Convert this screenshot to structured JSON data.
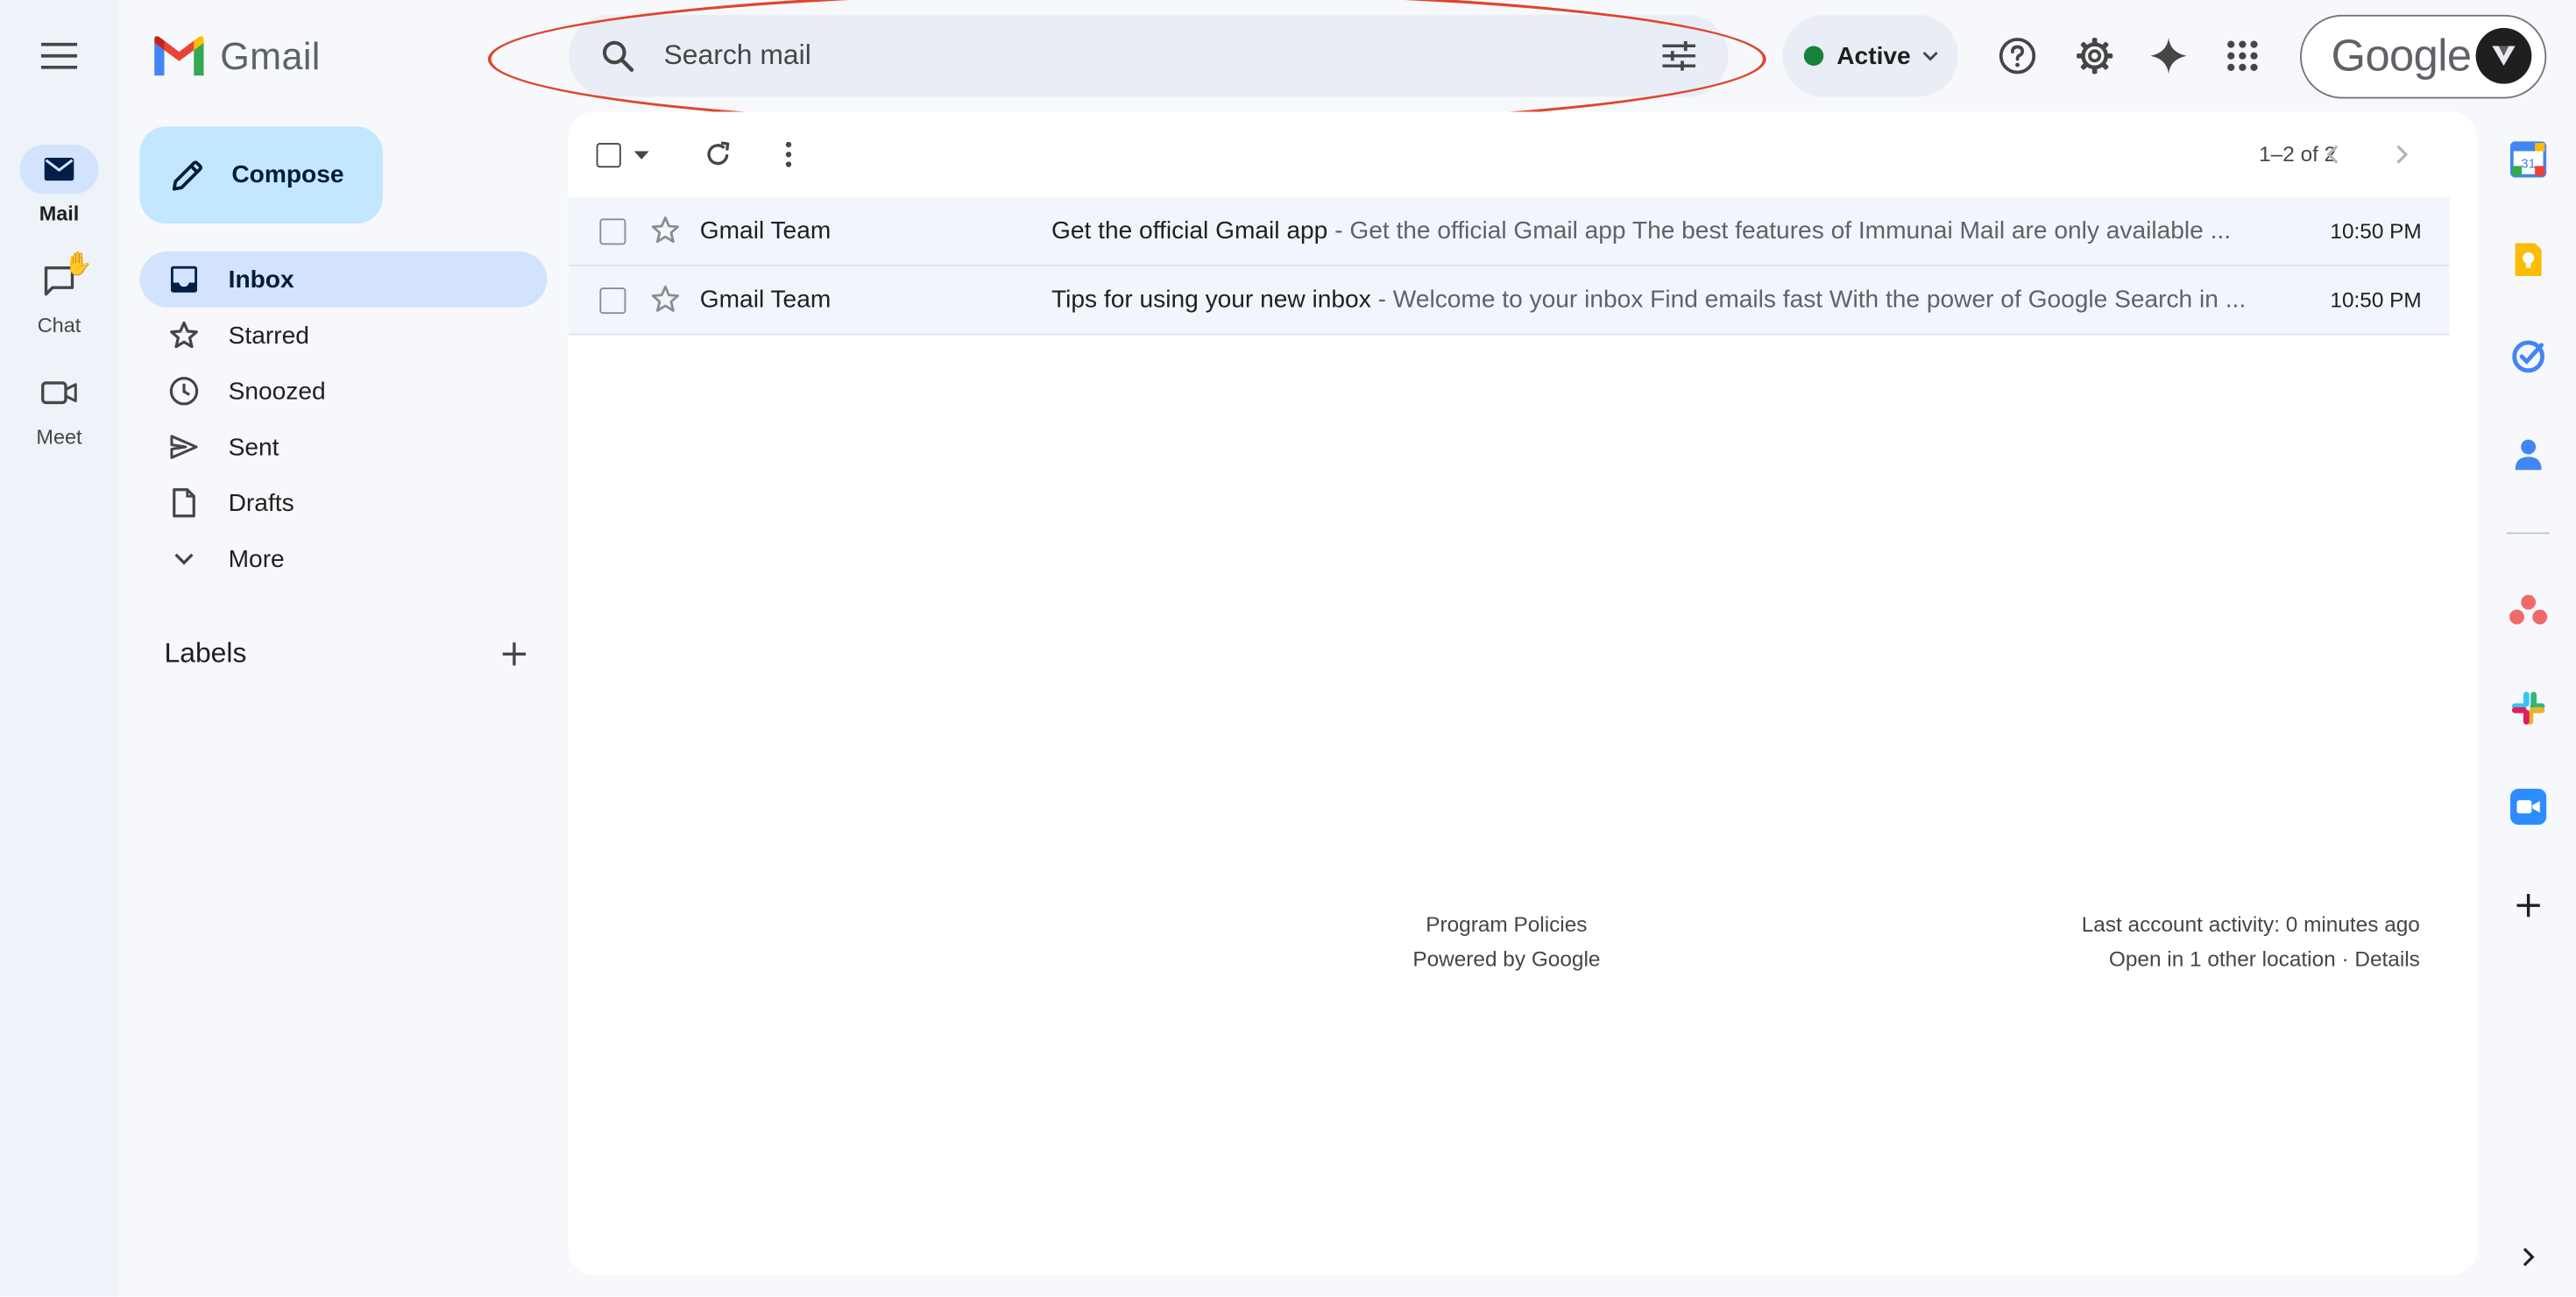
{
  "app": {
    "title": "Gmail",
    "brand_colors": {
      "red": "#ea4335",
      "blue": "#4285f4",
      "green": "#34a853",
      "yellow": "#fbbc04"
    }
  },
  "rail": {
    "items": [
      {
        "label": "Mail",
        "icon": "mail-icon",
        "active": true
      },
      {
        "label": "Chat",
        "icon": "chat-icon",
        "active": false
      },
      {
        "label": "Meet",
        "icon": "meet-icon",
        "active": false
      }
    ]
  },
  "search": {
    "placeholder": "Search mail",
    "value": ""
  },
  "status": {
    "label": "Active",
    "color": "#188038"
  },
  "account": {
    "brand": "Google"
  },
  "compose": {
    "label": "Compose"
  },
  "nav": {
    "items": [
      {
        "label": "Inbox",
        "icon": "inbox-icon",
        "active": true
      },
      {
        "label": "Starred",
        "icon": "star-icon",
        "active": false
      },
      {
        "label": "Snoozed",
        "icon": "clock-icon",
        "active": false
      },
      {
        "label": "Sent",
        "icon": "send-icon",
        "active": false
      },
      {
        "label": "Drafts",
        "icon": "draft-icon",
        "active": false
      },
      {
        "label": "More",
        "icon": "chevron-down-icon",
        "active": false
      }
    ]
  },
  "labels": {
    "title": "Labels"
  },
  "toolbar": {
    "page_info": "1–2 of 2"
  },
  "emails": [
    {
      "sender": "Gmail Team",
      "subject": "Get the official Gmail app",
      "separator": " - ",
      "snippet": "Get the official Gmail app The best features of Immunai Mail are only available ...",
      "time": "10:50 PM"
    },
    {
      "sender": "Gmail Team",
      "subject": "Tips for using your new inbox",
      "separator": " - ",
      "snippet": "Welcome to your inbox Find emails fast With the power of Google Search in ...",
      "time": "10:50 PM"
    }
  ],
  "footer": {
    "program_policies": "Program Policies",
    "powered_by": "Powered by Google",
    "last_activity": "Last account activity: 0 minutes ago",
    "other_location": "Open in 1 other location · Details"
  },
  "addons": [
    "calendar-icon",
    "keep-icon",
    "tasks-icon",
    "contacts-icon",
    "asana-icon",
    "slack-icon",
    "zoom-icon",
    "add-addon-icon"
  ]
}
